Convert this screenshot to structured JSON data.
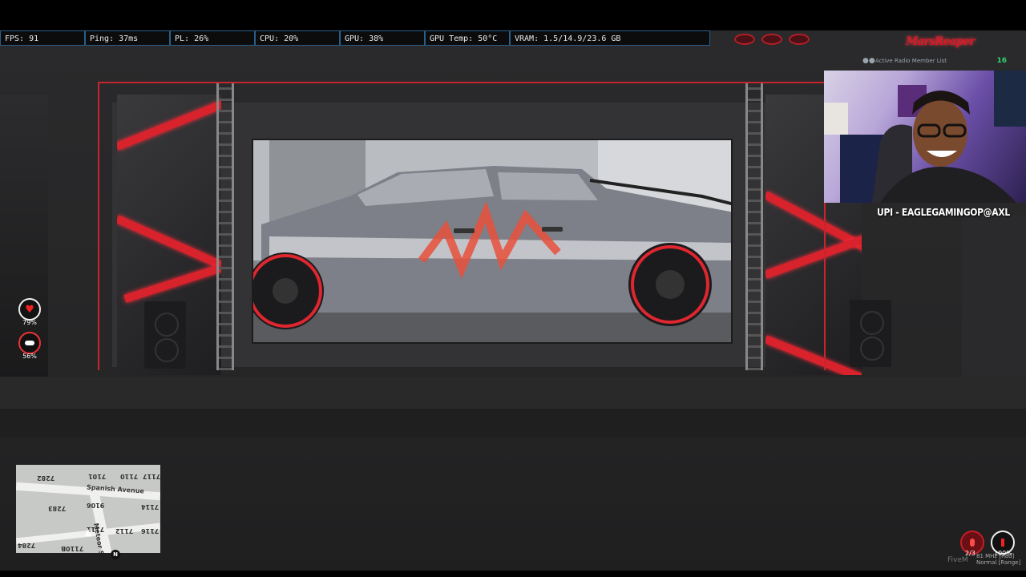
{
  "perf": {
    "fps": "FPS: 91",
    "ping": "Ping: 37ms",
    "pl": "PL: 26%",
    "cpu": "CPU: 20%",
    "gpu": "GPU: 38%",
    "gpu_temp": "GPU Temp: 50°C",
    "vram": "VRAM: 1.5/14.9/23.6 GB"
  },
  "brand": {
    "logo_text": "MarsReaper"
  },
  "radio_list": {
    "label": "Active Radio Member List",
    "count": "16"
  },
  "stream": {
    "upi": "UPI - EAGLEGAMINGOP@AXL"
  },
  "status": {
    "health": "79%",
    "armor": "56%"
  },
  "minimap": {
    "street_1": "Spanish Avenue",
    "street_2": "Meteor Street",
    "postals": [
      "7282",
      "7101",
      "7110",
      "7117",
      "7283",
      "9106",
      "7114",
      "7111",
      "7112",
      "7116",
      "7284",
      "7110B"
    ],
    "compass": "N"
  },
  "bottom_hud": {
    "mic_count": "2/3",
    "volume": "100%",
    "radio_freq": "81 MHz [Rad]",
    "radio_mode": "Normal [Range]",
    "watermark": "FiveM"
  },
  "colors": {
    "accent_red": "#d8222c",
    "panel_border": "#2a5e8a",
    "count_green": "#2fd46d"
  }
}
